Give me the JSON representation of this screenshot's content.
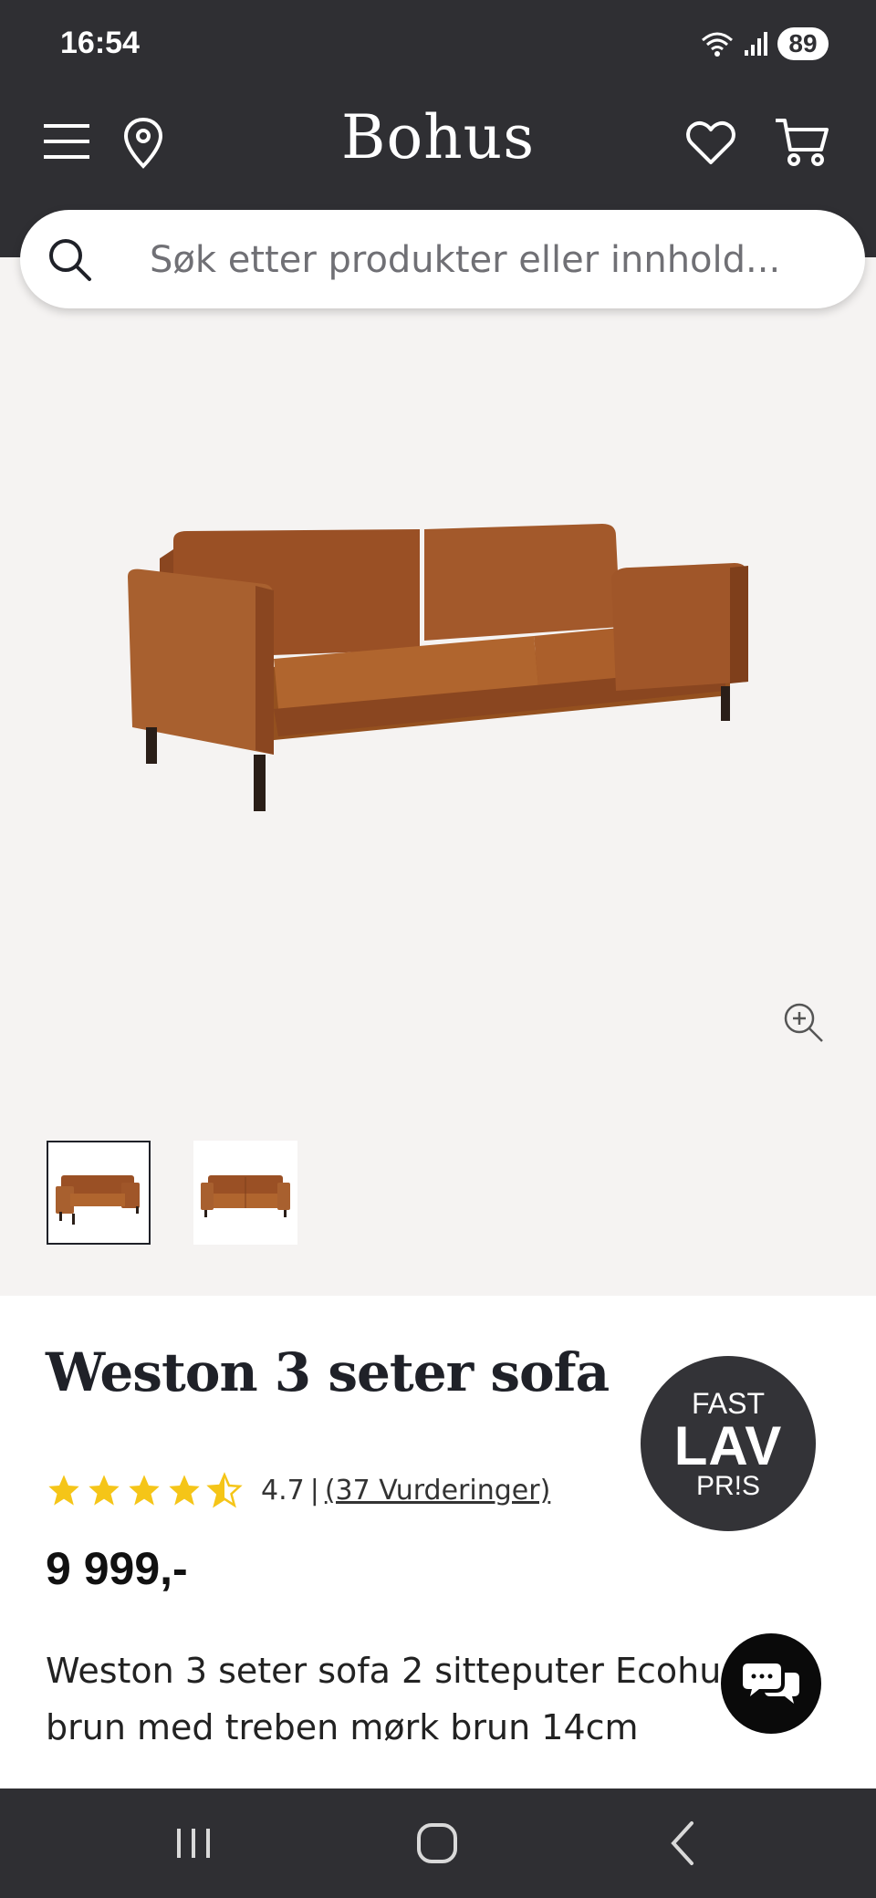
{
  "status_bar": {
    "time": "16:54",
    "battery": "89"
  },
  "header": {
    "logo": "Bohus"
  },
  "search": {
    "placeholder": "Søk etter produkter eller innhold..."
  },
  "product": {
    "title": "Weston 3 seter sofa",
    "rating": {
      "value": "4.7",
      "separator": "|",
      "reviews_link": "(37 Vurderinger)",
      "stars_filled": 4.5,
      "stars_total": 5
    },
    "price": "9 999,-",
    "description": "Weston 3 seter sofa 2 sitteputer Ecohud lys brun med treben mørk brun 14cm",
    "badge": {
      "line1": "FAST",
      "line2": "LAV",
      "line3": "PR!S"
    }
  },
  "colors": {
    "dark": "#2f2f33",
    "star": "#f5c518",
    "sofa": "#a3592b",
    "gallery_bg": "#f5f3f2"
  }
}
